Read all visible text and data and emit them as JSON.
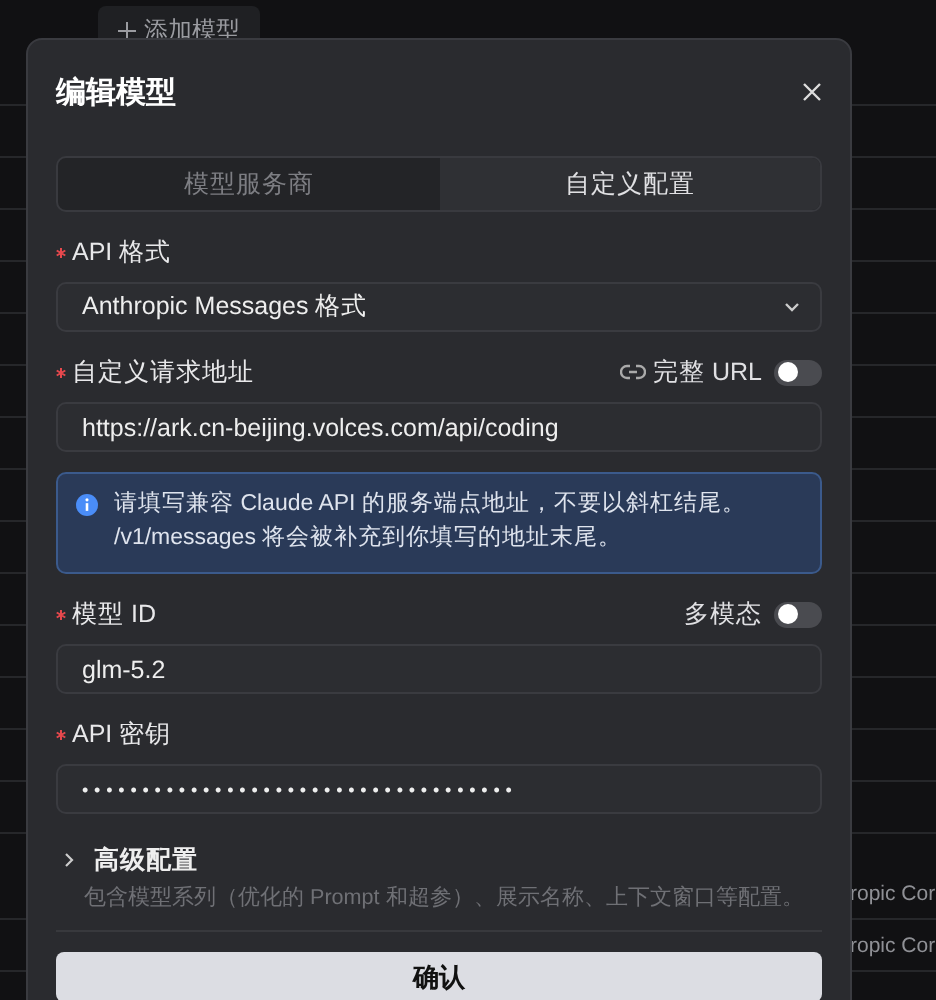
{
  "background": {
    "add_button": {
      "label": "添加模型"
    },
    "rows": [
      {
        "text": "ropic Cor"
      },
      {
        "text": "ropic Cor"
      }
    ]
  },
  "dialog": {
    "title": "编辑模型",
    "tabs": [
      {
        "label": "模型服务商",
        "selected": false
      },
      {
        "label": "自定义配置",
        "selected": true
      }
    ],
    "items": [
      {
        "kind": "select",
        "label": "API 格式",
        "required": true,
        "value": "Anthropic Messages 格式"
      },
      {
        "kind": "text",
        "label": "自定义请求地址",
        "required": true,
        "toggle": {
          "label": "完整 URL",
          "link_icon": true,
          "on": false
        },
        "value": "https://ark.cn-beijing.volces.com/api/coding"
      },
      {
        "kind": "notice",
        "text": "请填写兼容 Claude API 的服务端点地址，不要以斜杠结尾。 /v1/messages 将会被补充到你填写的地址末尾。"
      },
      {
        "kind": "text",
        "label": "模型 ID",
        "required": true,
        "toggle": {
          "label": "多模态",
          "on": false
        },
        "value": "glm-5.2"
      },
      {
        "kind": "password",
        "label": "API 密钥",
        "required": true,
        "value": "••••••••••••••••••••••••••••••••••••"
      }
    ],
    "advanced": {
      "title": "高级配置",
      "expanded": false,
      "description": "包含模型系列（优化的 Prompt 和超参）、展示名称、上下文窗口等配置。"
    },
    "confirm": "确认"
  }
}
